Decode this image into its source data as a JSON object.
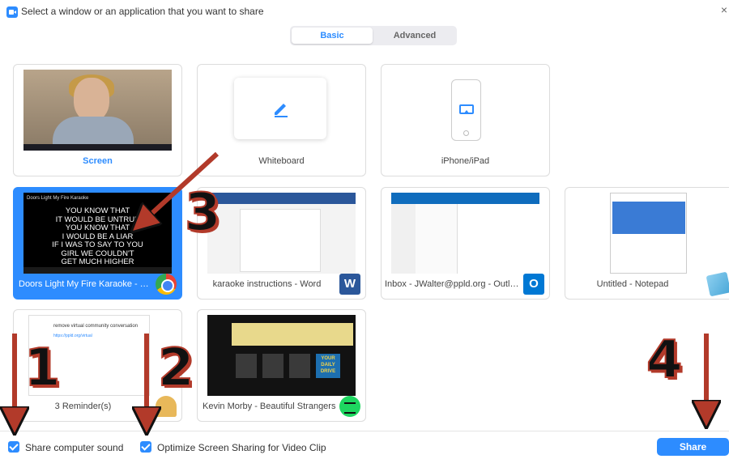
{
  "window": {
    "title": "Select a window or an application that you want to share",
    "close": "×"
  },
  "tabs": [
    {
      "label": "Basic",
      "selected": true
    },
    {
      "label": "Advanced",
      "selected": false
    }
  ],
  "tiles": [
    {
      "label": "Screen"
    },
    {
      "label": "Whiteboard"
    },
    {
      "label": "iPhone/iPad"
    },
    {
      "label": "Doors Light My Fire Karaoke - Yo...",
      "selected": true,
      "icon": "chrome-icon",
      "thumb_title": "Doors Light My Fire Karaoke",
      "lyrics": [
        "YOU KNOW THAT",
        "IT WOULD BE UNTRUE",
        "YOU KNOW THAT",
        "I WOULD BE A LIAR",
        "IF I WAS TO SAY TO YOU",
        "GIRL WE COULDN'T",
        "GET MUCH HIGHER"
      ]
    },
    {
      "label": "karaoke instructions - Word",
      "icon": "word-icon",
      "icon_glyph": "W"
    },
    {
      "label": "Inbox - JWalter@ppld.org - Outlo...",
      "icon": "outlook-icon",
      "icon_glyph": "O"
    },
    {
      "label": "Untitled - Notepad",
      "icon": "notepad-icon"
    },
    {
      "label": "3 Reminder(s)",
      "icon": "bell-icon",
      "thumb_heading": "remove virtual community conversation",
      "thumb_link": "https://ppld.org/virtual"
    },
    {
      "label": "Kevin Morby - Beautiful Strangers",
      "icon": "spotify-icon",
      "thumb_art": "YOUR DAILY DRIVE"
    }
  ],
  "footer": {
    "share_sound": {
      "label": "Share computer sound",
      "checked": true
    },
    "optimize": {
      "label": "Optimize Screen Sharing for Video Clip",
      "checked": true
    },
    "share_button": "Share"
  },
  "annotations": [
    "1",
    "2",
    "3",
    "4"
  ],
  "colors": {
    "accent": "#2d8cff",
    "arrow": "#b23a2a"
  }
}
